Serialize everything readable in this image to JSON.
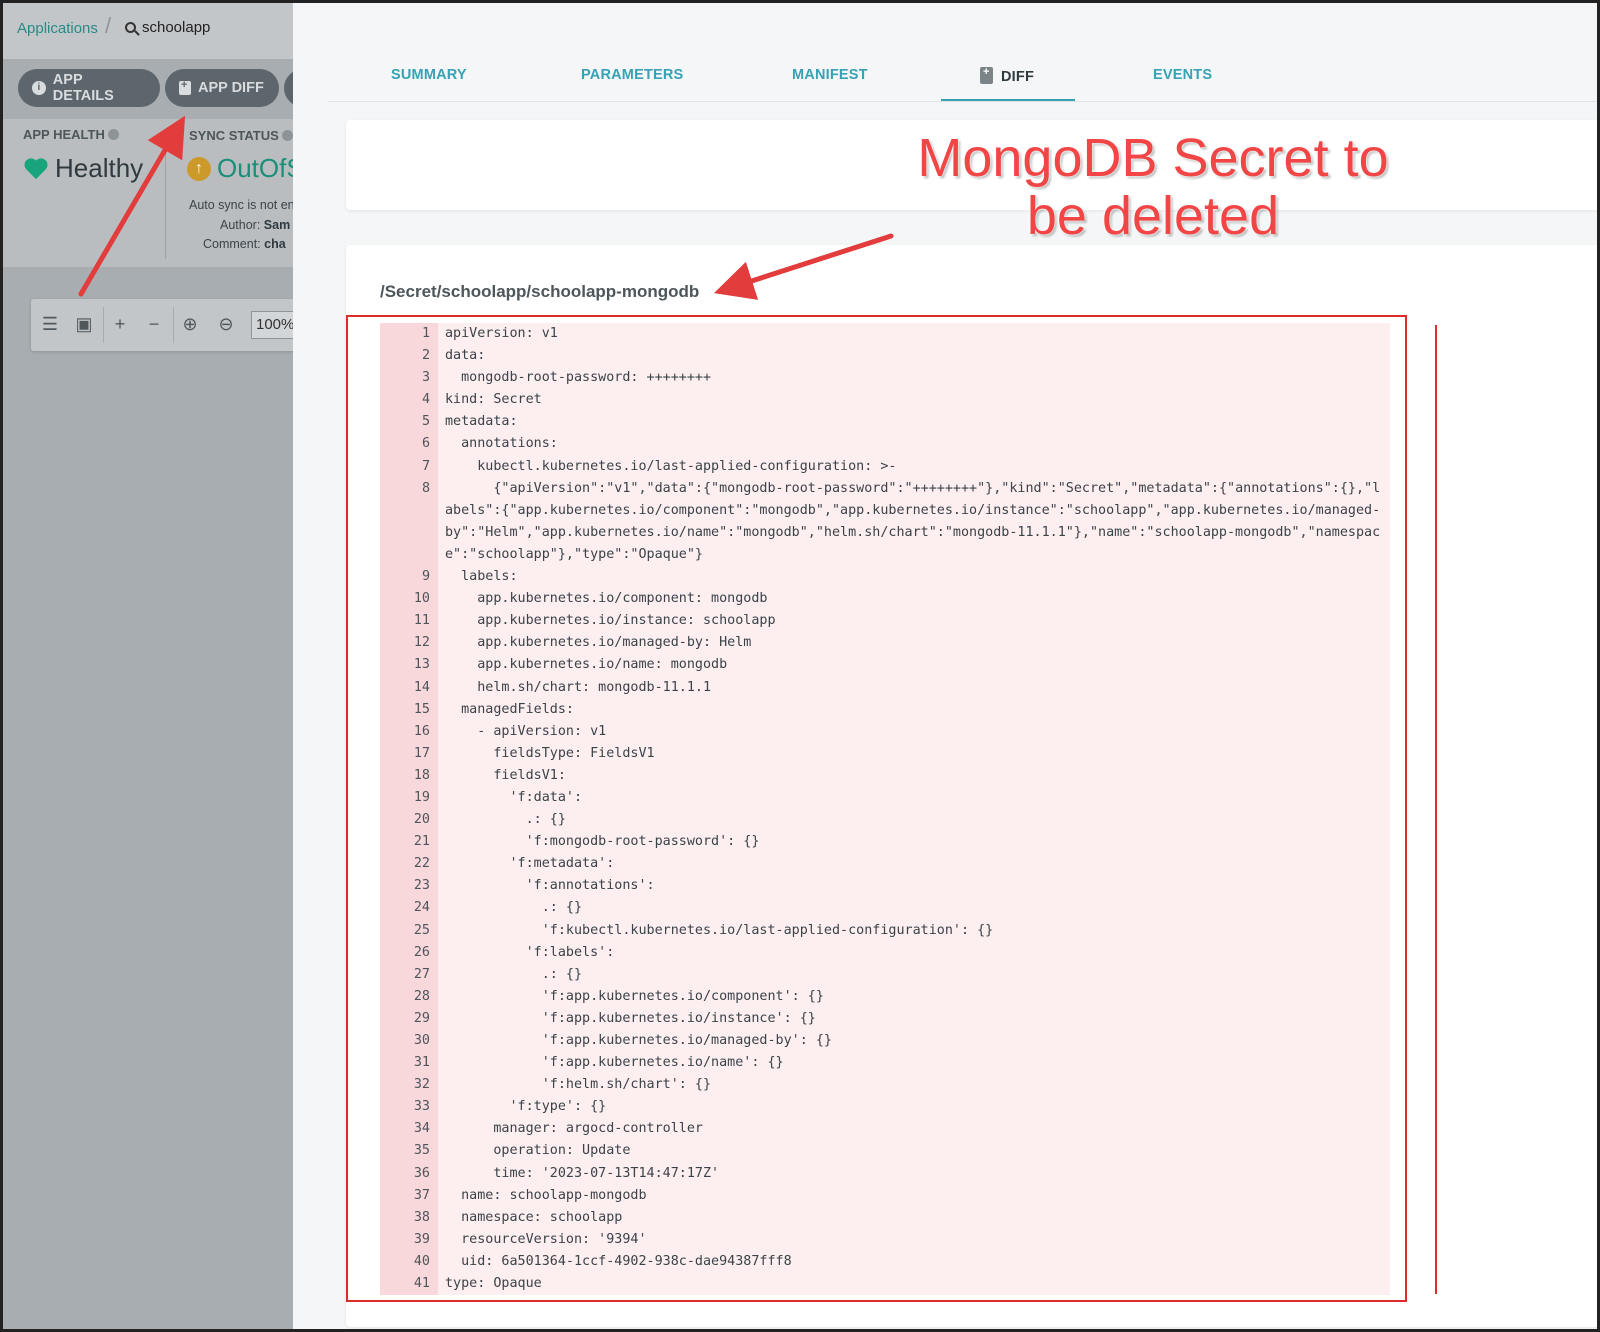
{
  "breadcrumb": {
    "applications": "Applications",
    "current_app": "schoolapp"
  },
  "actions": {
    "app_details": "APP DETAILS",
    "app_diff": "APP DIFF"
  },
  "status": {
    "app_health_label": "APP HEALTH",
    "app_health_value": "Healthy",
    "sync_status_label": "SYNC STATUS",
    "sync_status_value": "OutOfS",
    "auto_sync_text": "Auto sync is not en",
    "author_label": "Author:",
    "author_value": "Sam",
    "comment_label": "Comment:",
    "comment_value": "cha"
  },
  "graph_toolbar": {
    "zoom_value": "100%"
  },
  "tabs": [
    {
      "label": "SUMMARY"
    },
    {
      "label": "PARAMETERS"
    },
    {
      "label": "MANIFEST"
    },
    {
      "label": "DIFF",
      "active": true
    },
    {
      "label": "EVENTS"
    }
  ],
  "resource_path": "/Secret/schoolapp/schoolapp-mongodb",
  "annotation": {
    "line1": "MongoDB Secret to",
    "line2": "be deleted"
  },
  "colors": {
    "accent": "#36a2b4",
    "removed_bg": "#fdeef0",
    "removed_gutter": "#f9d8dc",
    "annotation_red": "#e02b2b",
    "healthy_green": "#18a57d"
  },
  "diff_lines": [
    "apiVersion: v1",
    "data:",
    "  mongodb-root-password: ++++++++",
    "kind: Secret",
    "metadata:",
    "  annotations:",
    "    kubectl.kubernetes.io/last-applied-configuration: >-",
    "      {\"apiVersion\":\"v1\",\"data\":{\"mongodb-root-password\":\"++++++++\"},\"kind\":\"Secret\",\"metadata\":{\"annotations\":{},\"labels\":{\"app.kubernetes.io/component\":\"mongodb\",\"app.kubernetes.io/instance\":\"schoolapp\",\"app.kubernetes.io/managed-by\":\"Helm\",\"app.kubernetes.io/name\":\"mongodb\",\"helm.sh/chart\":\"mongodb-11.1.1\"},\"name\":\"schoolapp-mongodb\",\"namespace\":\"schoolapp\"},\"type\":\"Opaque\"}",
    "  labels:",
    "    app.kubernetes.io/component: mongodb",
    "    app.kubernetes.io/instance: schoolapp",
    "    app.kubernetes.io/managed-by: Helm",
    "    app.kubernetes.io/name: mongodb",
    "    helm.sh/chart: mongodb-11.1.1",
    "  managedFields:",
    "    - apiVersion: v1",
    "      fieldsType: FieldsV1",
    "      fieldsV1:",
    "        'f:data':",
    "          .: {}",
    "          'f:mongodb-root-password': {}",
    "        'f:metadata':",
    "          'f:annotations':",
    "            .: {}",
    "            'f:kubectl.kubernetes.io/last-applied-configuration': {}",
    "          'f:labels':",
    "            .: {}",
    "            'f:app.kubernetes.io/component': {}",
    "            'f:app.kubernetes.io/instance': {}",
    "            'f:app.kubernetes.io/managed-by': {}",
    "            'f:app.kubernetes.io/name': {}",
    "            'f:helm.sh/chart': {}",
    "        'f:type': {}",
    "      manager: argocd-controller",
    "      operation: Update",
    "      time: '2023-07-13T14:47:17Z'",
    "  name: schoolapp-mongodb",
    "  namespace: schoolapp",
    "  resourceVersion: '9394'",
    "  uid: 6a501364-1ccf-4902-938c-dae94387fff8",
    "type: Opaque"
  ]
}
